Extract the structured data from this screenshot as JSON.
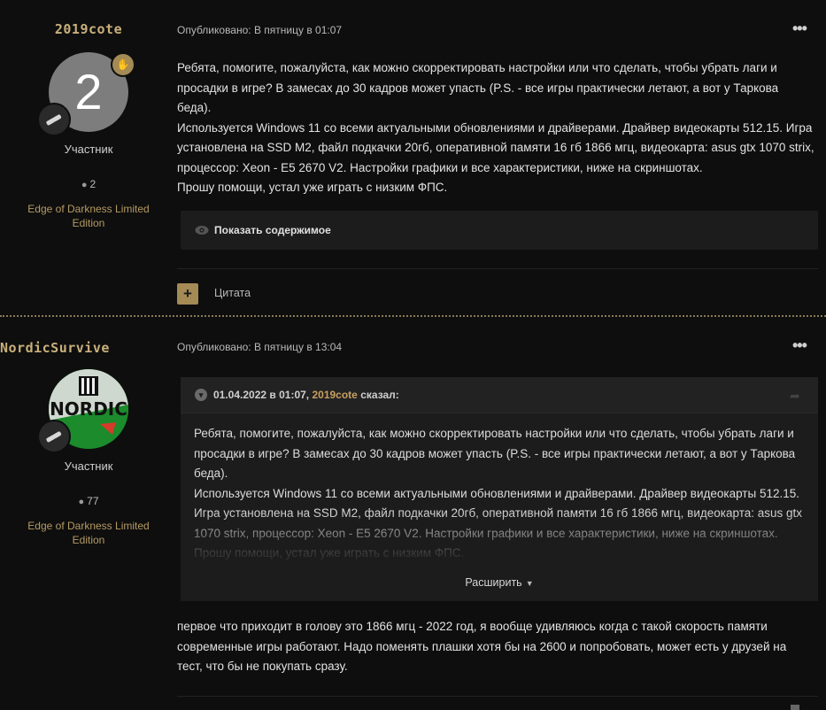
{
  "posts": [
    {
      "username": "2019cote",
      "avatar_letter": "2",
      "role": "Участник",
      "post_count": "2",
      "edition": "Edge of Darkness Limited Edition",
      "meta": "Опубликовано: В пятницу в 01:07",
      "more_icon": "•••",
      "body_lines": [
        "Ребята, помогите, пожалуйста, как можно скорректировать настройки или что сделать, чтобы убрать лаги и просадки в игре? В замесах до 30 кадров может упасть (P.S. - все игры практически летают, а вот у Таркова беда).",
        "Используется Windows 11 со всеми актуальными обновлениями и драйверами. Драйвер видеокарты 512.15. Игра установлена на SSD M2, файл подкачки 20гб, оперативной памяти 16 гб 1866 мгц, видеокарта: asus gtx 1070 strix, процессор: Xeon - E5 2670 V2. Настройки графики и все характеристики, ниже на скриншотах.",
        "Прошу помощи, устал уже играть с низким ФПС."
      ],
      "spoiler_label": "Показать содержимое",
      "quote_button_icon": "+",
      "quote_label": "Цитата"
    },
    {
      "username": "NordicSurvive",
      "avatar_text": "NORDIC",
      "role": "Участник",
      "post_count": "77",
      "edition": "Edge of Darkness Limited Edition",
      "meta": "Опубликовано: В пятницу в 13:04",
      "more_icon": "•••",
      "quote": {
        "date": "01.04.2022 в 01:07,",
        "author": "2019cote",
        "said": "сказал:",
        "lines": [
          "Ребята, помогите, пожалуйста, как можно скорректировать настройки или что сделать, чтобы убрать лаги и просадки в игре? В замесах до 30 кадров может упасть (P.S. - все игры практически летают, а вот у Таркова беда).",
          "Используется Windows 11 со всеми актуальными обновлениями и драйверами. Драйвер видеокарты 512.15. Игра установлена на SSD M2, файл подкачки 20гб, оперативной памяти 16 гб 1866 мгц, видеокарта: asus gtx 1070 strix, процессор: Xeon - E5 2670 V2. Настройки графики и все характеристики, ниже на скриншотах. Прошу помощи, устал уже играть с низким ФПС."
        ],
        "expand_label": "Расширить"
      },
      "body_lines": [
        "первое что приходит в голову это 1866 мгц - 2022 год, я  вообще удивляюсь когда с такой скорость памяти современные игры работают. Надо поменять плашки хотя бы на 2600 и попробовать, может есть у друзей на тест, что бы не покупать сразу."
      ]
    }
  ],
  "colors": {
    "background": "#0e0e0e",
    "accent": "#a48a55",
    "username": "#c9b07a",
    "edition": "#b49a62",
    "panel": "#1c1c1c"
  },
  "icons": {
    "online": "hand-icon",
    "rank": "bullets-icon",
    "posts": "chat-icon",
    "spoiler": "eye-icon",
    "quote_toggle": "chevron-down-icon",
    "quote_share": "share-icon",
    "expand": "caret-down-icon"
  }
}
